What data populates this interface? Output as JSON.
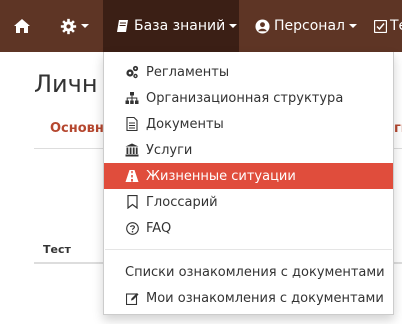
{
  "navbar": {
    "kb_label": "База знаний",
    "personal_label": "Персонал",
    "last_label": "Те"
  },
  "page": {
    "title": "Личн",
    "tab_left": "Основн",
    "tab_right": "ги",
    "table_header": "Тест"
  },
  "menu": {
    "items": [
      {
        "label": "Регламенты",
        "icon": "cogs-icon"
      },
      {
        "label": "Организационная структура",
        "icon": "sitemap-icon"
      },
      {
        "label": "Документы",
        "icon": "file-icon"
      },
      {
        "label": "Услуги",
        "icon": "bank-icon"
      },
      {
        "label": "Жизненные ситуации",
        "icon": "road-icon"
      },
      {
        "label": "Глоссарий",
        "icon": "bookmark-icon"
      },
      {
        "label": "FAQ",
        "icon": "question-icon"
      }
    ],
    "extra": [
      {
        "label": "Списки ознакомления с документами"
      },
      {
        "label": "Мои ознакомления с документами",
        "icon": "edit-icon"
      }
    ]
  },
  "colors": {
    "navbar": "#5e3525",
    "navbar_active": "#3b1f15",
    "highlight": "#e04d3c",
    "accent_text": "#b5472f"
  }
}
